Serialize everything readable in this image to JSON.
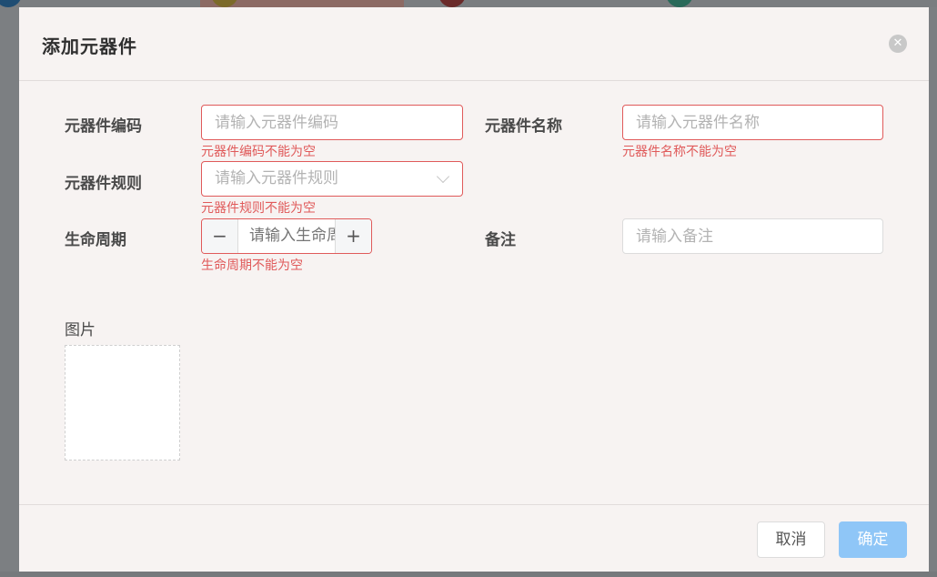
{
  "dialog": {
    "title": "添加元器件",
    "close_icon": "close-icon"
  },
  "form": {
    "code": {
      "label": "元器件编码",
      "placeholder": "请输入元器件编码",
      "error": "元器件编码不能为空"
    },
    "name": {
      "label": "元器件名称",
      "placeholder": "请输入元器件名称",
      "error": "元器件名称不能为空"
    },
    "rule": {
      "label": "元器件规则",
      "placeholder": "请输入元器件规则",
      "error": "元器件规则不能为空"
    },
    "lifecycle": {
      "label": "生命周期",
      "placeholder": "请输入生命周期",
      "error": "生命周期不能为空",
      "minus": "−",
      "plus": "+"
    },
    "remark": {
      "label": "备注",
      "placeholder": "请输入备注"
    },
    "image": {
      "label": "图片"
    }
  },
  "footer": {
    "cancel": "取消",
    "confirm": "确定"
  },
  "colors": {
    "error": "#e05a5a",
    "primary_disabled": "#8fc6f7"
  }
}
